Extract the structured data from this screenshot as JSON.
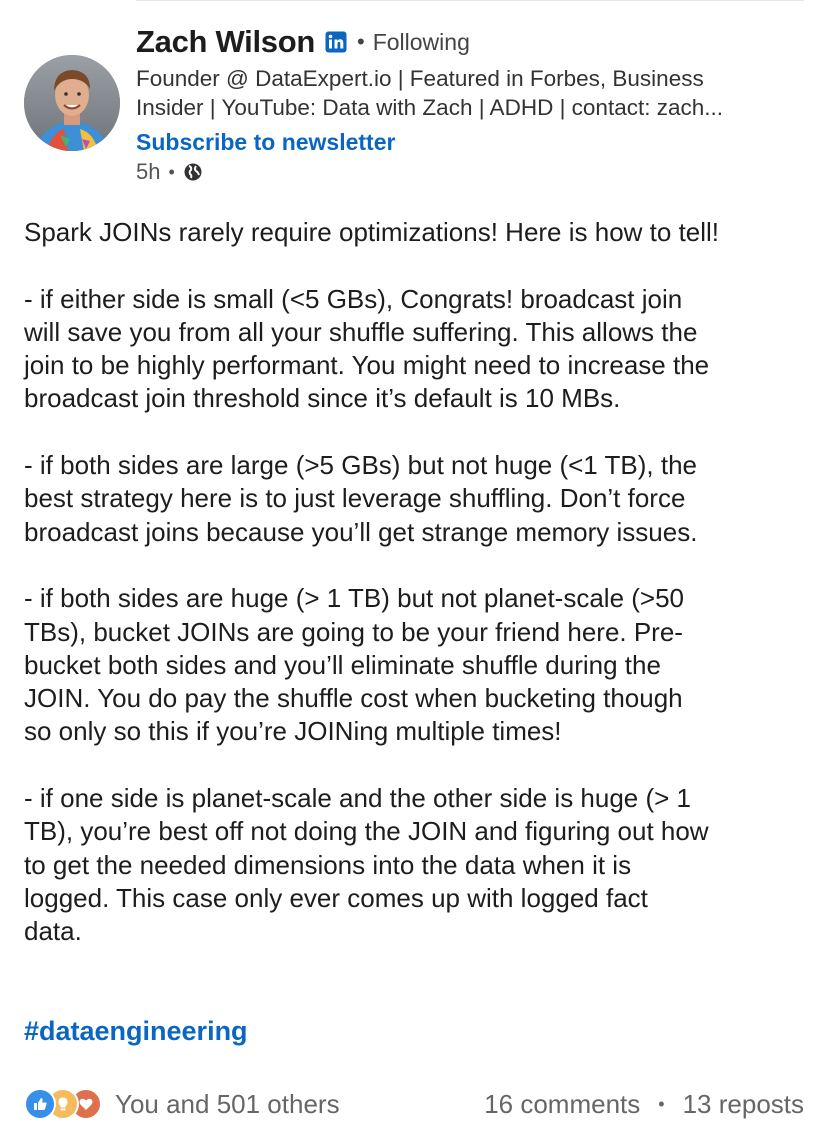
{
  "author": {
    "name": "Zach Wilson",
    "connection": "Following",
    "headline_lines": [
      "Founder @ DataExpert.io | Featured in Forbes, Business",
      "Insider | YouTube: Data with Zach | ADHD | contact: zach..."
    ],
    "subscribe_label": "Subscribe to newsletter",
    "time": "5h"
  },
  "icons": {
    "avatar": "profile-photo",
    "badge": "linkedin-icon",
    "visibility": "globe-icon",
    "reactions": [
      "like-icon",
      "insightful-icon",
      "love-icon"
    ]
  },
  "post": {
    "paragraphs": [
      [
        "Spark JOINs rarely require optimizations! Here is how to tell!"
      ],
      [
        "- if either side is small (<5 GBs), Congrats! broadcast join",
        "will save you from all your shuffle suffering. This allows the",
        "join to be highly performant. You might need to increase the",
        "broadcast join threshold since it’s default is 10 MBs."
      ],
      [
        "- if both sides are large (>5 GBs) but not huge (<1 TB), the",
        "best strategy here is to just leverage shuffling. Don’t force",
        "broadcast joins because you’ll get strange memory issues."
      ],
      [
        "- if both sides are huge (> 1 TB) but not planet-scale (>50",
        "TBs), bucket JOINs are going to be your friend here.  Pre-",
        "bucket both sides and you’ll eliminate shuffle during the",
        "JOIN. You do pay the shuffle cost when bucketing though",
        "so only so this if you’re JOINing multiple times!"
      ],
      [
        "- if one side is planet-scale and the other side is huge (> 1",
        "TB), you’re best off not doing the JOIN and figuring out how",
        "to get the needed dimensions into the data when it is",
        "logged.  This case only ever comes up with logged fact",
        "data."
      ]
    ],
    "hashtag": "#dataengineering"
  },
  "social": {
    "reactions_text": "You and 501 others",
    "comments": "16 comments",
    "reposts": "13 reposts"
  },
  "colors": {
    "link_blue": "#0a66c2",
    "like_blue": "#378fe9",
    "insight_yellow": "#f5bb5c",
    "love_red": "#df704d"
  }
}
